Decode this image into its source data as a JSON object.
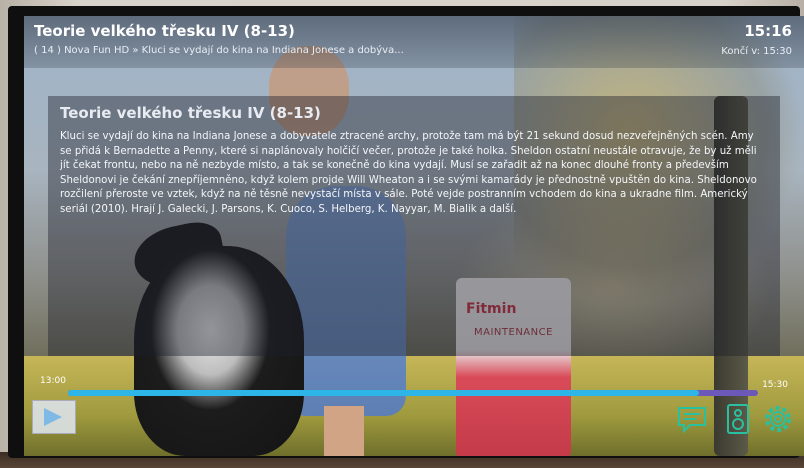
{
  "program": {
    "title": "Teorie velkého třesku IV (8-13)",
    "clock": "15:16",
    "channel_line": "( 14 ) Nova Fun HD  »  Kluci se vydají do kina na Indiana Jonese a dobýva...",
    "ends_at": "Končí v: 15:30"
  },
  "description": {
    "title": "Teorie velkého třesku IV (8-13)",
    "text": "Kluci se vydají do kina na Indiana Jonese a dobyvatele ztracené archy, protože tam má být 21 sekund dosud nezveřejněných scén. Amy se přidá k Bernadette a Penny, které si naplánovaly holčičí večer, protože je také holka. Sheldon ostatní neustále otravuje, že by už měli jít čekat frontu, nebo na ně nezbyde místo, a tak se konečně do kina vydají. Musí se zařadit až na konec dlouhé fronty a především Sheldonovi je čekání znepříjemněno, když kolem projde Will Wheaton a i se svými kamarády je přednostně vpuštěn do kina. Sheldonovo rozčilení přeroste ve vztek, když na ně těsně nevystačí místa v sále. Poté vejde postranním vchodem do kina a ukradne film. Americký seriál (2010). Hrají J. Galecki, J. Parsons, K. Cuoco, S. Helberg, K. Nayyar, M. Bialik a další."
  },
  "timeline": {
    "start": "13:00",
    "end": "15:30",
    "progress_percent": 91.5
  },
  "background": {
    "bag_brand": "Fitmin",
    "bag_label": "MAINTENANCE"
  },
  "icons": {
    "play": "play-icon",
    "subtitles": "subtitles-icon",
    "audio": "audio-track-icon",
    "settings": "settings-gear-icon"
  },
  "colors": {
    "progress_fill": "#2cb5e6",
    "progress_track": "#6b58b8",
    "icon_accent": "#29c0a0"
  }
}
